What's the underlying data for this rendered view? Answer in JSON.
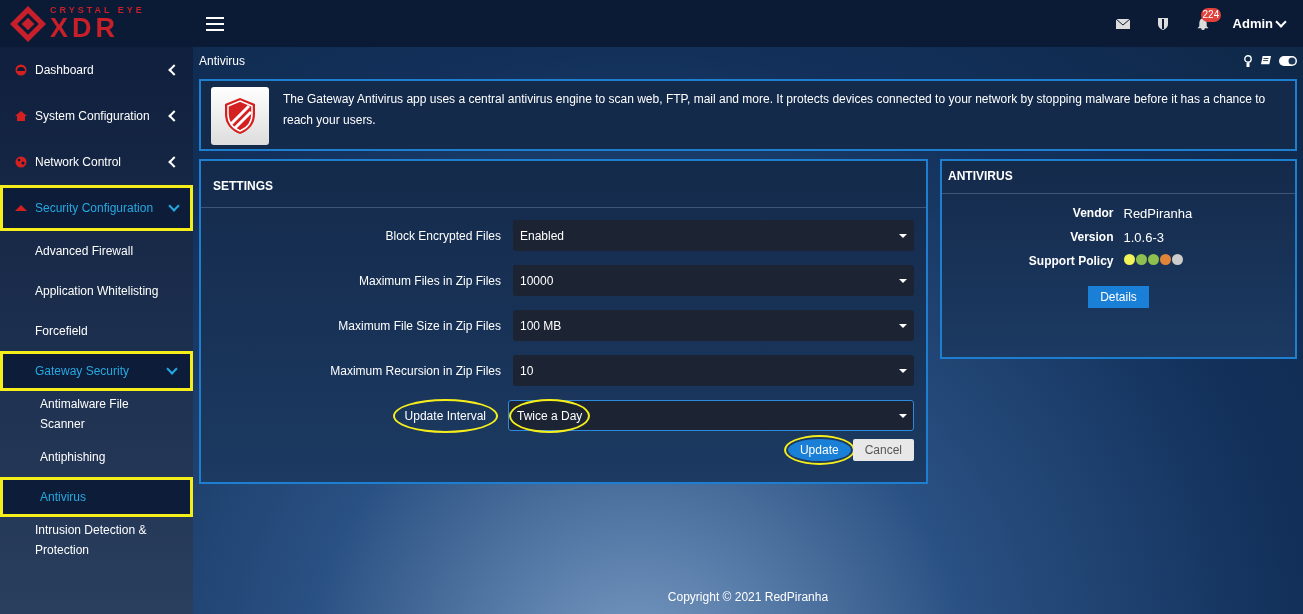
{
  "logo": {
    "tagline": "CRYSTAL EYE",
    "name": "XDR"
  },
  "topbar": {
    "notification_count": "224",
    "user": "Admin"
  },
  "sidebar": {
    "items": [
      {
        "label": "Dashboard",
        "expanded": false,
        "selected": false,
        "highlighted": false
      },
      {
        "label": "System Configuration",
        "expanded": false,
        "selected": false,
        "highlighted": false
      },
      {
        "label": "Network Control",
        "expanded": false,
        "selected": false,
        "highlighted": false
      },
      {
        "label": "Security Configuration",
        "expanded": true,
        "selected": true,
        "highlighted": true,
        "children": [
          {
            "label": "Advanced Firewall",
            "selected": false,
            "highlighted": false
          },
          {
            "label": "Application Whitelisting",
            "selected": false,
            "highlighted": false
          },
          {
            "label": "Forcefield",
            "selected": false,
            "highlighted": false
          },
          {
            "label": "Gateway Security",
            "expanded": true,
            "selected": true,
            "highlighted": true,
            "children": [
              {
                "label": "Antimalware File Scanner",
                "selected": false,
                "highlighted": false
              },
              {
                "label": "Antiphishing",
                "selected": false,
                "highlighted": false
              },
              {
                "label": "Antivirus",
                "selected": true,
                "highlighted": true
              }
            ]
          },
          {
            "label": "Intrusion Detection & Protection",
            "selected": false,
            "highlighted": false
          }
        ]
      }
    ]
  },
  "page": {
    "title": "Antivirus",
    "description": "The Gateway Antivirus app uses a central antivirus engine to scan web, FTP, mail and more. It protects devices connected to your network by stopping malware before it has a chance to reach your users."
  },
  "settings": {
    "title": "SETTINGS",
    "fields": [
      {
        "label": "Block Encrypted Files",
        "value": "Enabled",
        "highlighted": false
      },
      {
        "label": "Maximum Files in Zip Files",
        "value": "10000",
        "highlighted": false
      },
      {
        "label": "Maximum File Size in Zip Files",
        "value": "100 MB",
        "highlighted": false
      },
      {
        "label": "Maximum Recursion in Zip Files",
        "value": "10",
        "highlighted": false
      },
      {
        "label": "Update Interval",
        "value": "Twice a Day",
        "highlighted": true
      }
    ],
    "buttons": [
      {
        "label": "Update",
        "kind": "primary",
        "highlighted": true
      },
      {
        "label": "Cancel",
        "kind": "secondary",
        "highlighted": false
      }
    ]
  },
  "info": {
    "title": "ANTIVIRUS",
    "rows": [
      {
        "label": "Vendor",
        "value": "RedPiranha"
      },
      {
        "label": "Version",
        "value": "1.0.6-3"
      }
    ],
    "support_policy": {
      "label": "Support Policy",
      "dots": [
        {
          "color": "#f3f35a"
        },
        {
          "color": "#8fbf4f"
        },
        {
          "color": "#8fbf4f"
        },
        {
          "color": "#e0843a"
        },
        {
          "color": "#cccccc"
        }
      ]
    },
    "button": "Details"
  },
  "footer": "Copyright © 2021 RedPiranha"
}
